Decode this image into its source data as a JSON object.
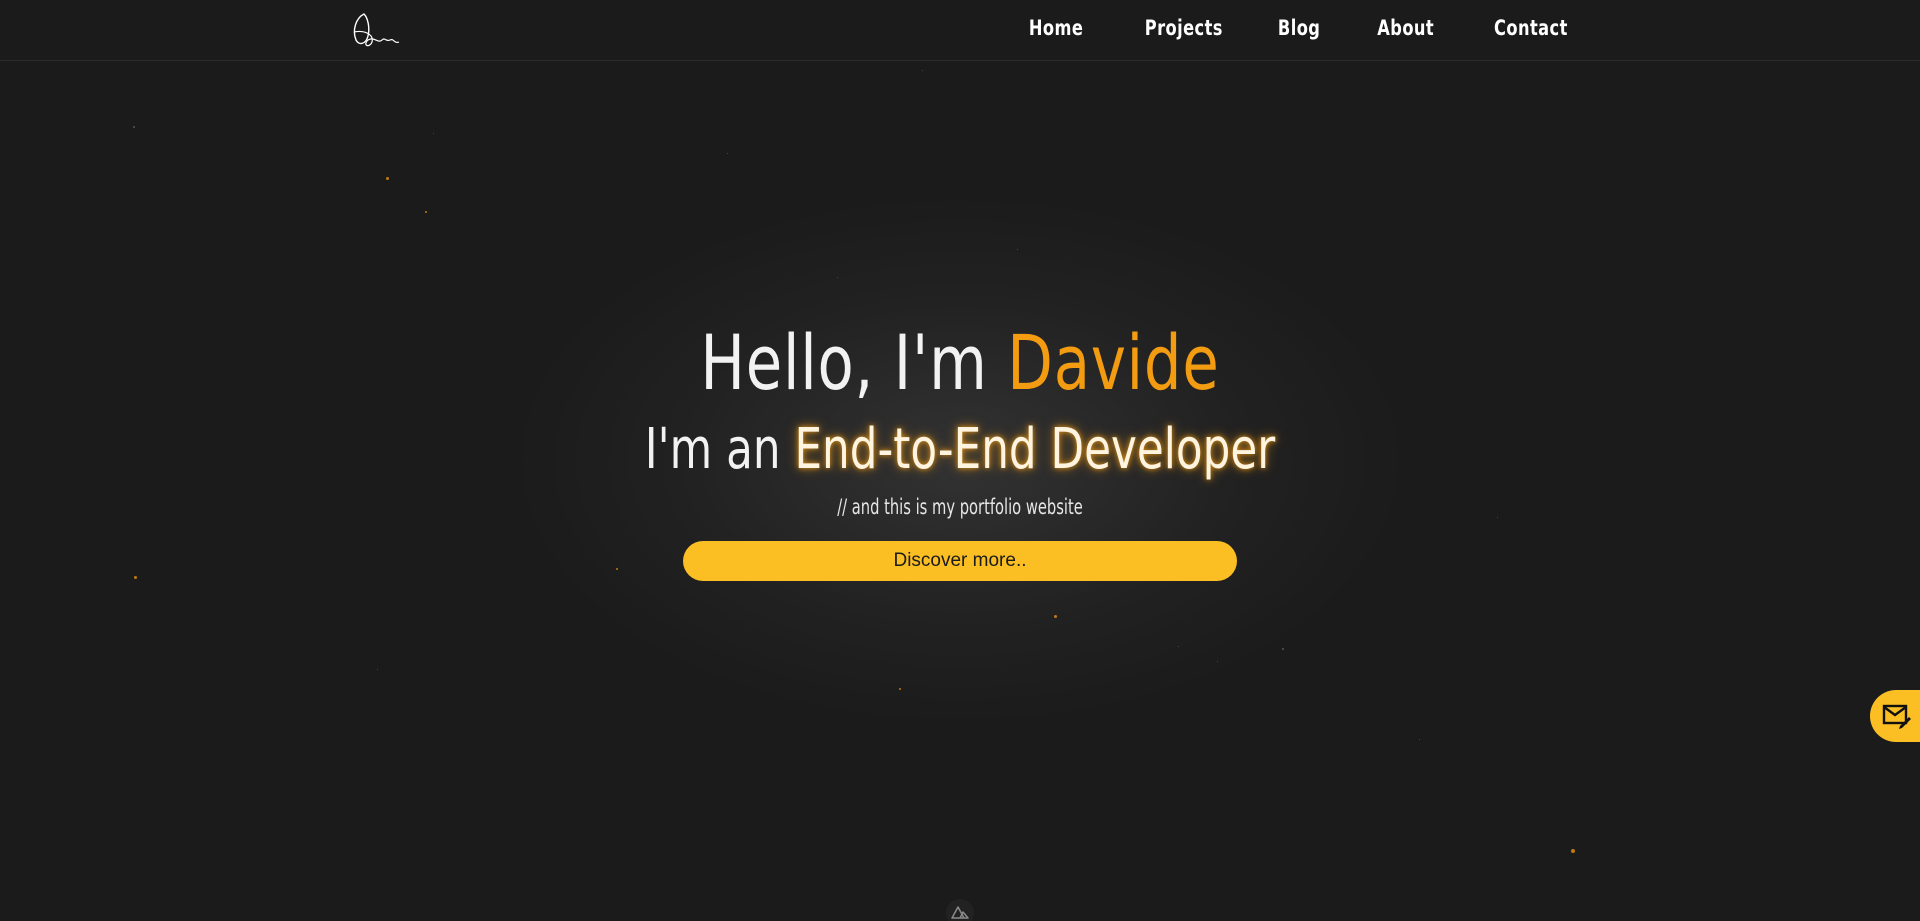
{
  "header": {
    "logo_alt": "signature-logo",
    "nav": [
      {
        "label": "Home"
      },
      {
        "label": "Projects"
      },
      {
        "label": "Blog"
      },
      {
        "label": "About"
      },
      {
        "label": "Contact"
      }
    ]
  },
  "hero": {
    "greeting": "Hello, I'm ",
    "name": "Davide",
    "role_prefix": "I'm an ",
    "role": "End-to-End Developer",
    "subtitle": "// and this is my portfolio website",
    "cta_label": "Discover more.."
  },
  "floating_contact": {
    "icon": "mail-edit-icon"
  },
  "footer": {
    "icon": "nuxt-icon"
  },
  "colors": {
    "background": "#1b1b1b",
    "accent": "#f39c12",
    "button": "#fbbf24",
    "text": "#ffffff"
  }
}
